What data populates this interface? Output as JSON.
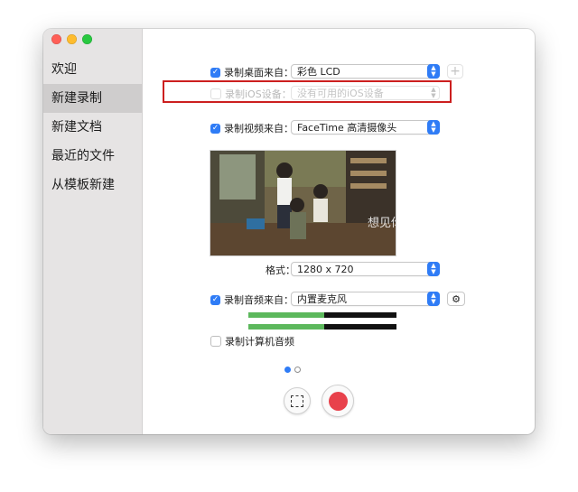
{
  "sidebar": {
    "items": [
      {
        "label": "欢迎"
      },
      {
        "label": "新建录制"
      },
      {
        "label": "新建文档"
      },
      {
        "label": "最近的文件"
      },
      {
        "label": "从模板新建"
      }
    ],
    "active_index": 1
  },
  "screen_row": {
    "checkbox_checked": true,
    "label": "录制桌面来自：",
    "value": "彩色 LCD",
    "add_label": "+"
  },
  "ios_row": {
    "checkbox_checked": false,
    "enabled": false,
    "label": "录制iOS设备：",
    "value": "没有可用的iOS设备"
  },
  "video_row": {
    "checkbox_checked": true,
    "label": "录制视频来自：",
    "value": "FaceTime 高清摄像头"
  },
  "preview": {
    "watermark": "想见你"
  },
  "format_row": {
    "label": "格式：",
    "value": "1280 x 720"
  },
  "audio_row": {
    "checkbox_checked": true,
    "label": "录制音频来自：",
    "value": "内置麦克风",
    "settings_icon": "gear-icon"
  },
  "audio_levels": [
    0.51,
    0.51
  ],
  "computer_audio_row": {
    "checkbox_checked": false,
    "label": "录制计算机音频"
  },
  "pager": {
    "current": 1,
    "total": 2
  },
  "colors": {
    "accent": "#2f7cf6",
    "record": "#e8414b",
    "highlight": "#cc1f1f",
    "meter": "#5cb85c"
  }
}
